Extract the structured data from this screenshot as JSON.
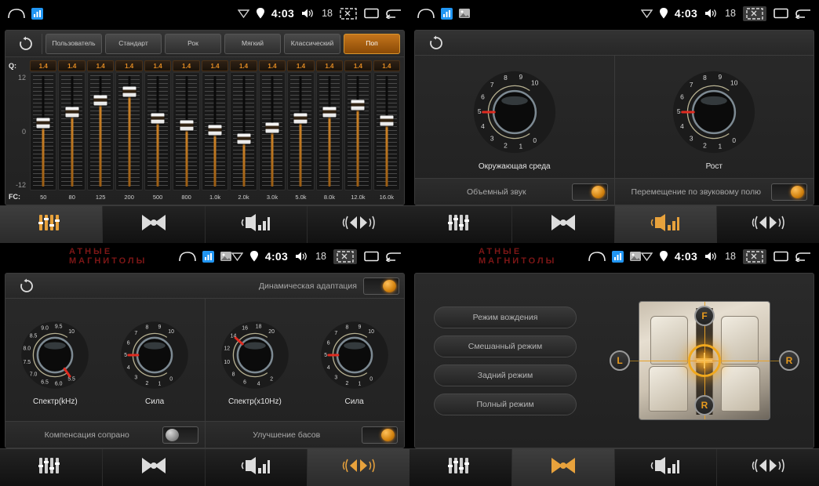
{
  "statusbar": {
    "time": "4:03",
    "volume": "18",
    "icons": [
      "home-icon",
      "app-icon",
      "gallery-icon",
      "wifi-icon",
      "location-icon",
      "volume-icon",
      "screenshot-icon",
      "recents-icon",
      "back-icon"
    ]
  },
  "watermark": "АТНЫЕ  МАГНИТОЛЫ",
  "panels": {
    "equalizer": {
      "reset_icon": "reset-icon",
      "presets": [
        {
          "label": "Пользователь",
          "active": false
        },
        {
          "label": "Стандарт",
          "active": false
        },
        {
          "label": "Рок",
          "active": false
        },
        {
          "label": "Мягкий",
          "active": false
        },
        {
          "label": "Классический",
          "active": false
        },
        {
          "label": "Поп",
          "active": true
        }
      ],
      "q_row_label": "Q:",
      "fc_row_label": "FC:",
      "scale": {
        "top": "12",
        "mid": "0",
        "bottom": "-12"
      },
      "bands": [
        {
          "fc": "50",
          "q": "1.4",
          "gain": 1.5
        },
        {
          "fc": "80",
          "q": "1.4",
          "gain": 4.0
        },
        {
          "fc": "125",
          "q": "1.4",
          "gain": 6.5
        },
        {
          "fc": "200",
          "q": "1.4",
          "gain": 8.5
        },
        {
          "fc": "500",
          "q": "1.4",
          "gain": 2.5
        },
        {
          "fc": "800",
          "q": "1.4",
          "gain": 1.0
        },
        {
          "fc": "1.0k",
          "q": "1.4",
          "gain": 0.0
        },
        {
          "fc": "2.0k",
          "q": "1.4",
          "gain": -2.0
        },
        {
          "fc": "3.0k",
          "q": "1.4",
          "gain": 0.5
        },
        {
          "fc": "5.0k",
          "q": "1.4",
          "gain": 2.5
        },
        {
          "fc": "8.0k",
          "q": "1.4",
          "gain": 4.0
        },
        {
          "fc": "12.0k",
          "q": "1.4",
          "gain": 5.5
        },
        {
          "fc": "16.0k",
          "q": "1.4",
          "gain": 2.0
        }
      ]
    },
    "surround": {
      "reset_icon": "reset-icon",
      "knobs": [
        {
          "label": "Окружающая среда",
          "min": 0,
          "max": 10,
          "value": 5,
          "ticks": [
            "0",
            "1",
            "2",
            "3",
            "4",
            "5",
            "6",
            "7",
            "8",
            "9",
            "10"
          ]
        },
        {
          "label": "Рост",
          "min": 0,
          "max": 10,
          "value": 5,
          "ticks": [
            "0",
            "1",
            "2",
            "3",
            "4",
            "5",
            "6",
            "7",
            "8",
            "9",
            "10"
          ]
        }
      ],
      "toggles": [
        {
          "label": "Объемный звук",
          "on": true
        },
        {
          "label": "Перемещение по звуковому полю",
          "on": true
        }
      ]
    },
    "effects": {
      "reset_icon": "reset-icon",
      "header_toggle": {
        "label": "Динамическая адаптация",
        "on": true
      },
      "knobs": [
        {
          "label": "Спектр(kHz)",
          "value": 5.5,
          "ticks": [
            "5.5",
            "6.0",
            "6.5",
            "7.0",
            "7.5",
            "8.0",
            "8.5",
            "9.0",
            "9.5",
            "10"
          ]
        },
        {
          "label": "Сила",
          "value": 5,
          "ticks": [
            "0",
            "1",
            "2",
            "3",
            "4",
            "5",
            "6",
            "7",
            "8",
            "9",
            "10"
          ]
        },
        {
          "label": "Спектр(x10Hz)",
          "value": 14,
          "ticks": [
            "2",
            "4",
            "6",
            "8",
            "10",
            "12",
            "14",
            "16",
            "18",
            "20"
          ]
        },
        {
          "label": "Сила",
          "value": 5,
          "ticks": [
            "0",
            "1",
            "2",
            "3",
            "4",
            "5",
            "6",
            "7",
            "8",
            "9",
            "10"
          ]
        }
      ],
      "toggles": [
        {
          "label": "Компенсация сопрано",
          "on": false
        },
        {
          "label": "Улучшение басов",
          "on": true
        }
      ]
    },
    "balance": {
      "modes": [
        {
          "label": "Режим вождения"
        },
        {
          "label": "Смешанный режим"
        },
        {
          "label": "Задний режим"
        },
        {
          "label": "Полный режим"
        }
      ],
      "directions": {
        "front": "F",
        "left": "L",
        "right": "R",
        "rear": "R"
      }
    }
  },
  "tabs": [
    {
      "name": "equalizer",
      "icon": "equalizer-sliders-icon",
      "active_in": [
        0
      ]
    },
    {
      "name": "balance",
      "icon": "balance-fader-icon",
      "active_in": [
        3
      ]
    },
    {
      "name": "effects",
      "icon": "sound-effects-icon",
      "active_in": [
        1
      ]
    },
    {
      "name": "surround",
      "icon": "surround-sound-icon",
      "active_in": [
        2
      ]
    }
  ]
}
